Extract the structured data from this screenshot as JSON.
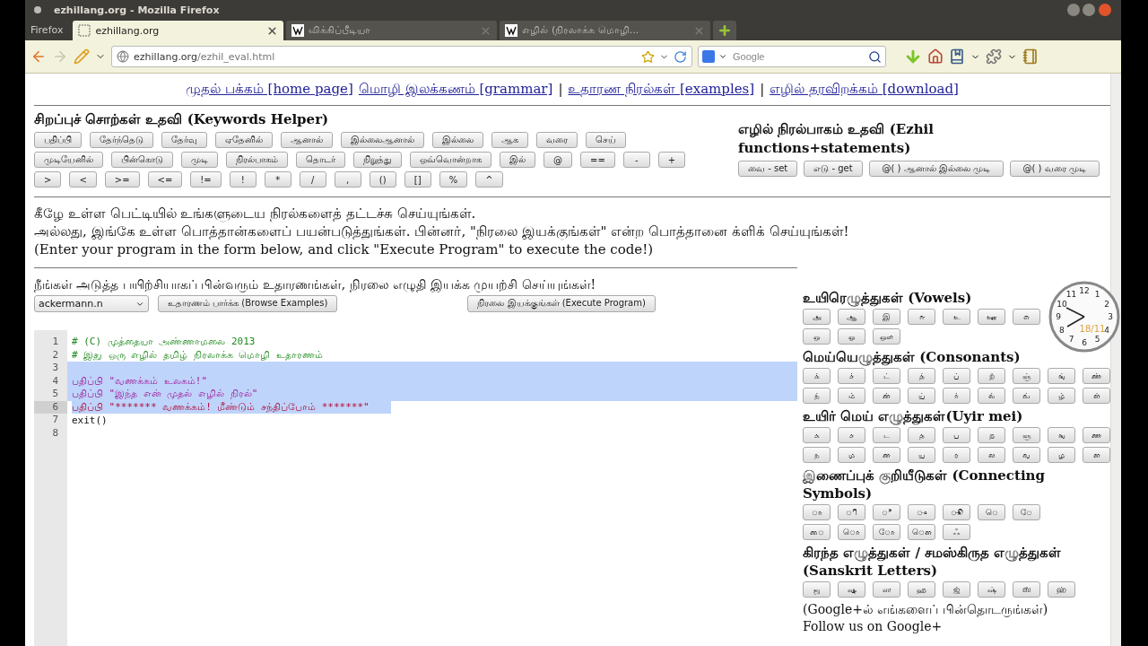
{
  "window": {
    "title": "ezhillang.org - Mozilla Firefox",
    "app_button": "Firefox"
  },
  "tabs": [
    {
      "label": "ezhillang.org",
      "selected": true,
      "kind": "blank"
    },
    {
      "label": "விக்கிப்பீடியா",
      "selected": false,
      "kind": "wiki"
    },
    {
      "label": "எழில் (நிரலாக்க மொழி...",
      "selected": false,
      "kind": "wiki"
    }
  ],
  "address": {
    "host": "ezhillang.org",
    "path": "/ezhil_eval.html"
  },
  "search": {
    "placeholder": "Google"
  },
  "nav": [
    {
      "kind": "link",
      "text": "முதல் பக்கம் [home page]"
    },
    {
      "kind": "link",
      "text": "மொழி இலக்கணம் [grammar]"
    },
    {
      "kind": "separator",
      "text": "|"
    },
    {
      "kind": "link",
      "text": "உதாரண நிரல்கள் [examples]"
    },
    {
      "kind": "separator",
      "text": "|"
    },
    {
      "kind": "link",
      "text": "எழில் தரவிறக்கம் [download]"
    }
  ],
  "keywords_helper": {
    "title": "சிறப்புச் சொற்கள் உதவி (Keywords Helper)",
    "buttons": [
      "பதிப்பி",
      "தேர்ந்தெடு",
      "தேர்வு",
      "ஏதேனில்",
      "ஆனால்",
      "இல்லைஆனால்",
      "இல்லை",
      "ஆக",
      "வரை",
      "செய்",
      "முடியேனில்",
      "பின்கொடு",
      "முடி",
      "நிரல்பாகம்",
      "தொடர்",
      "நிறுத்து",
      "ஒவ்வொன்றாக",
      "இல்",
      "@",
      "==",
      "-",
      "+",
      ">",
      "<",
      ">=",
      "<=",
      "!=",
      "!",
      "*",
      "/",
      ",",
      "()",
      "[]",
      "%",
      "^"
    ]
  },
  "functions_helper": {
    "title": "எழில் நிரல்பாகம் உதவி (Ezhil functions+statements)",
    "buttons": [
      "வை - set",
      "எடு - get",
      "@( ) ஆனால் இல்லை முடி",
      "@( ) வரை முடி"
    ]
  },
  "instructions": [
    "கீழே உள்ள பெட்டியில் உங்களுடைய நிரல்களைத் தட்டச்சு செய்யுங்கள்.",
    "அல்லது, இங்கே உள்ள பொத்தான்களைப் பயன்படுத்துங்கள். பின்னர், \"நிரலை இயக்குங்கள்\" என்ற பொத்தானை க்ளிக் செய்யுங்கள்!",
    "(Enter your program in the form below, and click \"Execute Program\" to execute the code!)"
  ],
  "examples": {
    "prompt": "நீங்கள் அடுத்த பயிற்சியாகப் பின்வரும் உதாரணங்கள், நிரலை எழுதி இயக்க முயற்சி செய்யுங்கள்!",
    "select": "ackermann.n",
    "browse_button": "உதாரணம் பார்க்க (Browse Examples)",
    "execute_button": "நிரலை இயக்குங்கள் (Execute Program)"
  },
  "editor": {
    "lines": [
      {
        "number": "1",
        "kind": "comment",
        "text": "# (C) முத்தையா அண்ணாமலை 2013",
        "selected": false,
        "current": false
      },
      {
        "number": "2",
        "kind": "comment",
        "text": "# இது ஒரு எழில் தமிழ் நிரலாக்க மொழி உதாரணம்",
        "selected": false,
        "current": false
      },
      {
        "number": "3",
        "selected": true,
        "current": false
      },
      {
        "number": "4",
        "kind": "print",
        "text": "பதிப்பி \"வணக்கம் உலகம்!\"",
        "selected": true,
        "current": false
      },
      {
        "number": "5",
        "kind": "print",
        "text": "பதிப்பி \"இந்த என் முதல் எழில் நிரல்\"",
        "selected": true,
        "current": false
      },
      {
        "number": "6",
        "kind": "print-active",
        "text": "பதிப்பி \"******* வணக்கம்! மீண்டும் சந்திப்போம் *******\"",
        "selected": true,
        "current": true
      },
      {
        "number": "7",
        "kind": "plain",
        "text": "exit()",
        "selected": false,
        "current": false
      },
      {
        "number": "8",
        "selected": false,
        "current": false
      }
    ]
  },
  "letters": [
    {
      "title": "உயிரெழுத்துகள் (Vowels)",
      "rows": [
        [
          "அ",
          "ஆ",
          "இ",
          "ஈ",
          "உ",
          "ஊ",
          "எ"
        ],
        [
          "ஒ",
          "ஓ",
          "ஔ"
        ]
      ]
    },
    {
      "title": "மெய்யெழுத்துகள் (Consonants)",
      "rows": [
        [
          "க்",
          "ச்",
          "ட்",
          "த்",
          "ப்",
          "ற்",
          "ஞ்",
          "ங்",
          "ண்"
        ],
        [
          "ந்",
          "ம்",
          "ன்",
          "ய்",
          "ர்",
          "ல்",
          "வ்",
          "ழ்",
          "ள்"
        ]
      ]
    },
    {
      "title": "உயிர் மெய் எழுத்துகள்(Uyir mei)",
      "rows": [
        [
          "க",
          "ச",
          "ட",
          "த",
          "ப",
          "ற",
          "ஞ",
          "ங",
          "ண"
        ],
        [
          "ந",
          "ம",
          "ன",
          "ய",
          "ர",
          "ல",
          "வ",
          "ழ",
          "ள"
        ]
      ]
    },
    {
      "title": "இணைப்புக் குறியீடுகள் (Connecting Symbols)",
      "rows": [
        [
          "◌ா",
          "◌ி",
          "◌ீ",
          "◌ு",
          "◌ூ",
          "◌ெ",
          "◌ே"
        ],
        [
          "◌ை",
          "◌ொ",
          "◌ோ",
          "◌ௌ",
          "ஃ"
        ]
      ]
    },
    {
      "title": "கிரந்த எழுத்துகள் / சமஸ்கிருத எழுத்துகள் (Sanskrit Letters)",
      "rows": [
        [
          "ஜ",
          "ஷ",
          "ஸ",
          "ஹ",
          "ஜ்",
          "ஷ்",
          "ஸ்",
          "ஹ்"
        ]
      ]
    }
  ],
  "follow": [
    "(Google+ல் எங்களைப் பின்தொடருங்கள்)",
    "Follow us on Google+"
  ],
  "clock": {
    "numerals": [
      "12",
      "11",
      "1",
      "10",
      "2",
      "9",
      "3",
      "8",
      "4",
      "7",
      "5",
      "6"
    ],
    "date": "18/11"
  }
}
